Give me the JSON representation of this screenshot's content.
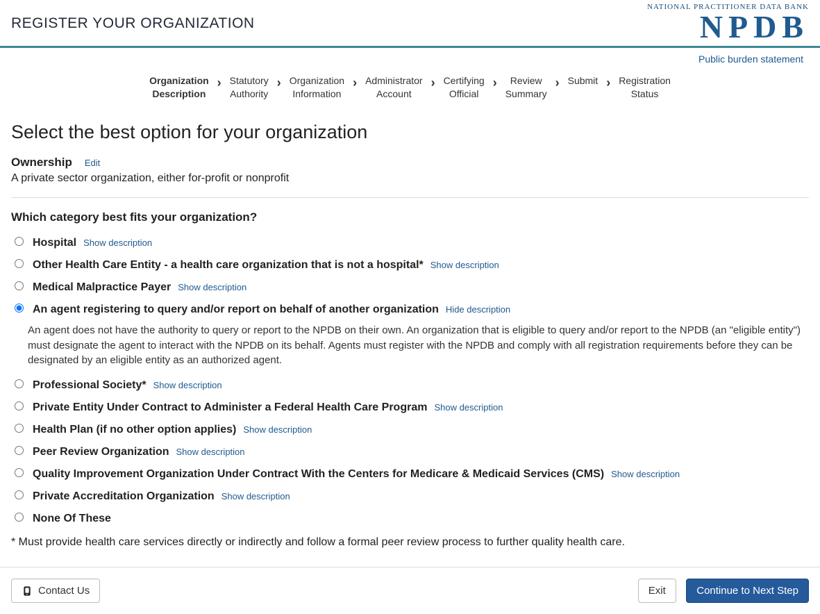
{
  "header": {
    "title": "REGISTER YOUR ORGANIZATION",
    "logo_small": "NATIONAL PRACTITIONER DATA BANK",
    "logo_big": "NPDB",
    "burden_link": "Public burden statement"
  },
  "steps": [
    "Organization\nDescription",
    "Statutory\nAuthority",
    "Organization\nInformation",
    "Administrator\nAccount",
    "Certifying\nOfficial",
    "Review\nSummary",
    "Submit",
    "Registration\nStatus"
  ],
  "active_step_index": 0,
  "section": {
    "title": "Select the best option for your organization",
    "ownership_label": "Ownership",
    "edit_label": "Edit",
    "ownership_desc": "A private sector organization, either for-profit or nonprofit",
    "question": "Which category best fits your organization?"
  },
  "links": {
    "show": "Show description",
    "hide": "Hide description"
  },
  "options": [
    {
      "label": "Hospital",
      "selected": false,
      "has_desc": true
    },
    {
      "label": "Other Health Care Entity - a health care organization that is not a hospital*",
      "selected": false,
      "has_desc": true
    },
    {
      "label": "Medical Malpractice Payer",
      "selected": false,
      "has_desc": true
    },
    {
      "label": "An agent registering to query and/or report on behalf of another organization",
      "selected": true,
      "has_desc": true,
      "desc": "An agent does not have the authority to query or report to the NPDB on their own. An organization that is eligible to query and/or report to the NPDB (an \"eligible entity\") must designate the agent to interact with the NPDB on its behalf. Agents must register with the NPDB and comply with all registration requirements before they can be designated by an eligible entity as an authorized agent."
    },
    {
      "label": "Professional Society*",
      "selected": false,
      "has_desc": true
    },
    {
      "label": "Private Entity Under Contract to Administer a Federal Health Care Program",
      "selected": false,
      "has_desc": true
    },
    {
      "label": "Health Plan (if no other option applies)",
      "selected": false,
      "has_desc": true
    },
    {
      "label": "Peer Review Organization",
      "selected": false,
      "has_desc": true
    },
    {
      "label": "Quality Improvement Organization Under Contract With the Centers for Medicare & Medicaid Services (CMS)",
      "selected": false,
      "has_desc": true
    },
    {
      "label": "Private Accreditation Organization",
      "selected": false,
      "has_desc": true
    },
    {
      "label": "None Of These",
      "selected": false,
      "has_desc": false
    }
  ],
  "footnote": "* Must provide health care services directly or indirectly and follow a formal peer review process to further quality health care.",
  "footer": {
    "contact": "Contact Us",
    "exit": "Exit",
    "next": "Continue to Next Step"
  }
}
